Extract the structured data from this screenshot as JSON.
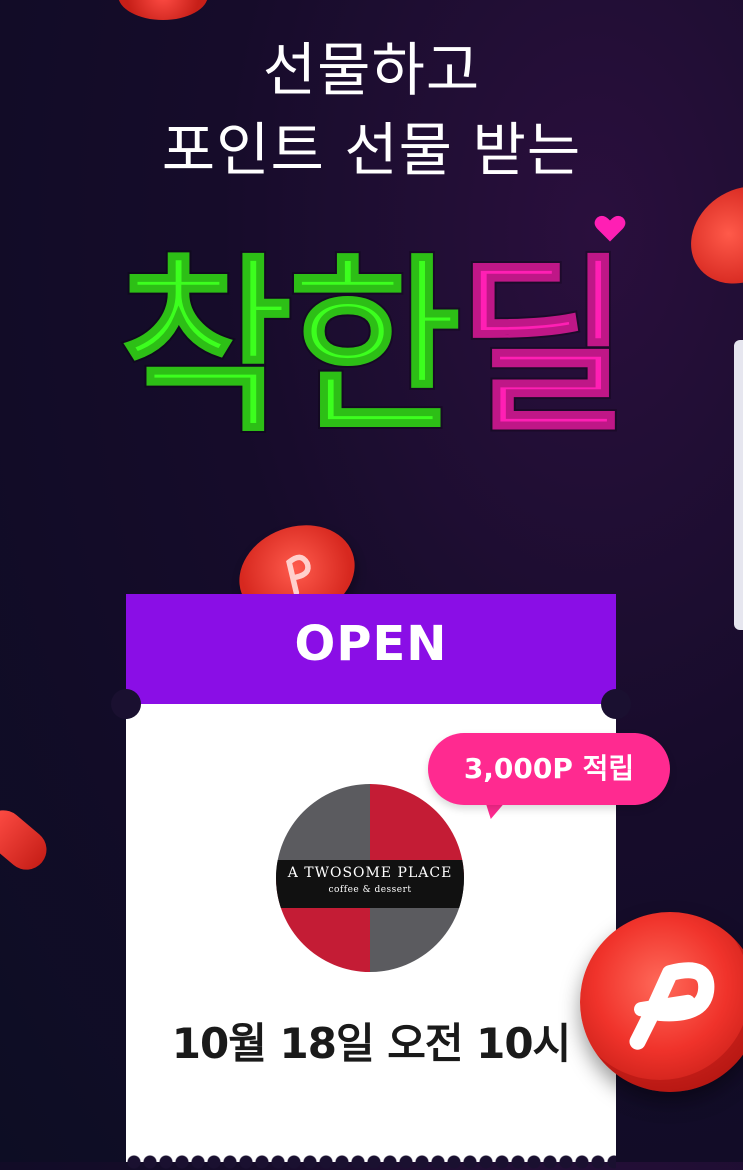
{
  "headline": {
    "line1": "선물하고",
    "line2": "포인트 선물 받는"
  },
  "logo": {
    "part1": "착한",
    "part2": "딜"
  },
  "ticket": {
    "status_label": "OPEN",
    "reward_badge": "3,000P 적립",
    "brand": {
      "name": "A TWOSOME PLACE",
      "tagline": "coffee & dessert"
    },
    "open_datetime": "10월 18일 오전 10시"
  },
  "colors": {
    "background": "#160c2a",
    "accent_purple": "#8a0ee6",
    "logo_green": "#3cff1e",
    "logo_pink": "#ff1fb4",
    "badge_pink": "#ff2a90",
    "coin_red": "#f0332b"
  },
  "icons": [
    "heart-icon",
    "point-coin-icon"
  ]
}
